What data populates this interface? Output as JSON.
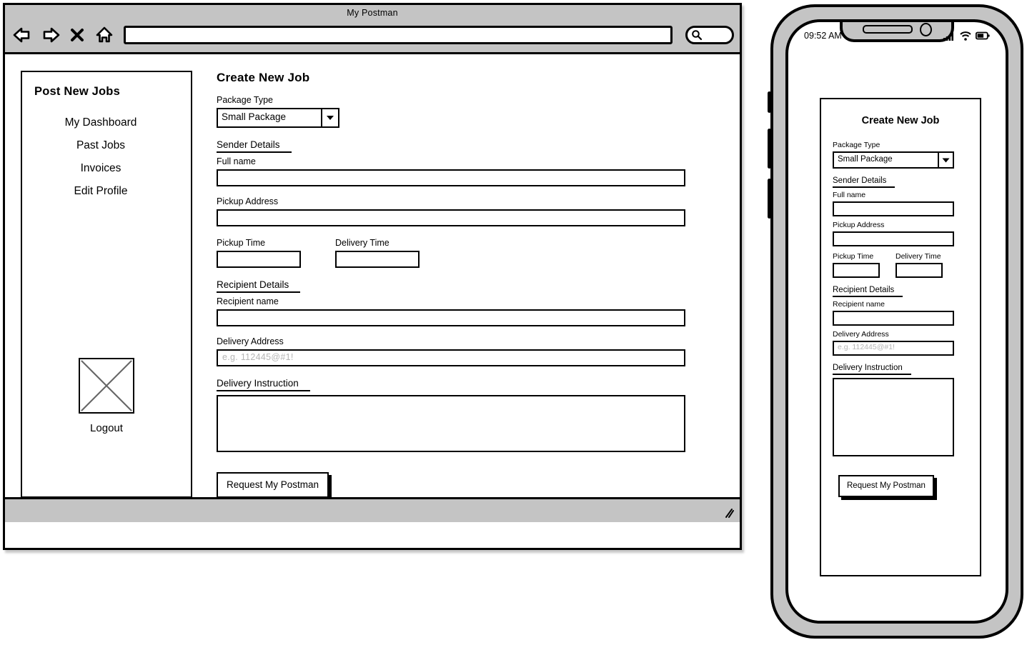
{
  "browser": {
    "window_title": "My Postman",
    "url_value": "",
    "nav_icons": [
      {
        "name": "back-arrow-icon",
        "label": "Back"
      },
      {
        "name": "forward-arrow-icon",
        "label": "Forward"
      },
      {
        "name": "close-icon",
        "label": "Close"
      },
      {
        "name": "home-icon",
        "label": "Home"
      }
    ],
    "search_icon": "search-icon",
    "resize_grip_icon": "resize-grip-icon"
  },
  "sidebar": {
    "title": "Post New Jobs",
    "items": [
      {
        "label": "My Dashboard"
      },
      {
        "label": "Past Jobs"
      },
      {
        "label": "Invoices"
      },
      {
        "label": "Edit Profile"
      }
    ],
    "logout": {
      "label": "Logout",
      "image_icon": "image-placeholder-icon"
    }
  },
  "form": {
    "title": "Create New Job",
    "package_type": {
      "label": "Package Type",
      "value": "Small Package",
      "options": [
        "Small Package"
      ],
      "arrow_icon": "chevron-down-icon"
    },
    "sender_section": "Sender Details",
    "full_name": {
      "label": "Full name",
      "value": "",
      "placeholder": ""
    },
    "pickup_address": {
      "label": "Pickup Address",
      "value": "",
      "placeholder": ""
    },
    "pickup_time": {
      "label": "Pickup Time",
      "value": "",
      "placeholder": ""
    },
    "delivery_time": {
      "label": "Delivery Time",
      "value": "",
      "placeholder": ""
    },
    "recipient_section": "Recipient Details",
    "recipient_name": {
      "label": "Recipient name",
      "value": "",
      "placeholder": ""
    },
    "delivery_address": {
      "label": "Delivery Address",
      "value": "",
      "placeholder": "e.g. 112445@#1!"
    },
    "delivery_instruction": {
      "label": "Delivery Instruction",
      "value": "",
      "placeholder": ""
    },
    "submit_label": "Request My Postman"
  },
  "phone": {
    "status": {
      "time": "09:52 AM",
      "signal_icon": "signal-bars-icon",
      "wifi_icon": "wifi-icon",
      "battery_icon": "battery-icon"
    },
    "form": {
      "title": "Create New Job",
      "package_type": {
        "label": "Package Type",
        "value": "Small Package",
        "arrow_icon": "chevron-down-icon"
      },
      "sender_section": "Sender Details",
      "full_name": {
        "label": "Full name",
        "value": ""
      },
      "pickup_address": {
        "label": "Pickup Address",
        "value": ""
      },
      "pickup_time": {
        "label": "Pickup Time",
        "value": ""
      },
      "delivery_time": {
        "label": "Delivery Time",
        "value": ""
      },
      "recipient_section": "Recipient Details",
      "recipient_name": {
        "label": "Recipient name",
        "value": ""
      },
      "delivery_address": {
        "label": "Delivery Address",
        "value": "",
        "placeholder": "e.g. 112445@#1!"
      },
      "delivery_instruction": {
        "label": "Delivery Instruction",
        "value": ""
      },
      "submit_label": "Request My Postman"
    }
  },
  "colors": {
    "chrome_gray": "#c4c4c4",
    "ink": "#000000",
    "placeholder_gray": "#b5b5b5",
    "page_bg": "#ffffff"
  }
}
